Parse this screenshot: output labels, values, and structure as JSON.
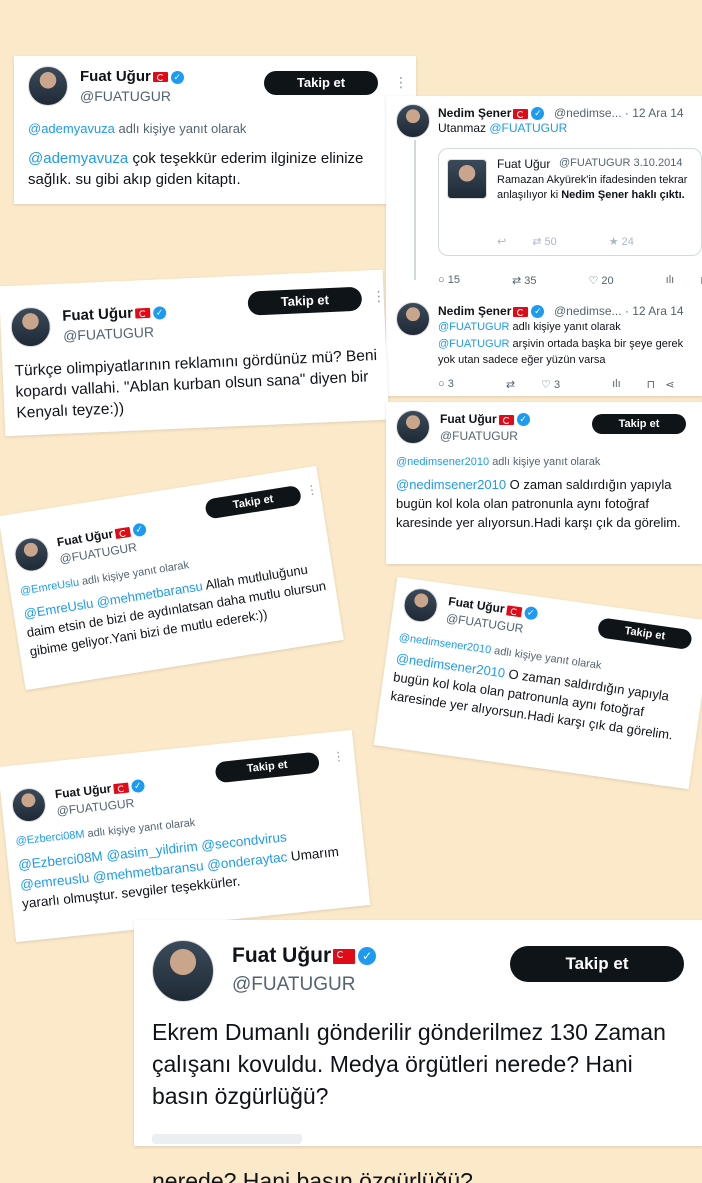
{
  "common": {
    "name": "Fuat Uğur",
    "handle": "@FUATUGUR",
    "follow": "Takip et",
    "reply_suffix": "adlı kişiye yanıt olarak",
    "more": "⋮"
  },
  "tweet1": {
    "reply_to": "@ademyavuza",
    "mention": "@ademyavuza",
    "text": " çok teşekkür ederim ilginize elinize sağlık. su gibi akıp giden kitaptı."
  },
  "nedim_thread": {
    "name": "Nedim Şener",
    "handle_time": "@nedimse... · 12 Ara 14",
    "text_prefix": "Utanmaz ",
    "text_mention": "@FUATUGUR",
    "quote": {
      "name": "Fuat Uğur",
      "handle_date": "@FUATUGUR 3.10.2014",
      "text": "Ramazan Akyürek'in ifadesinden tekrar anlaşılıyor ki ",
      "bold": "Nedim Şener haklı çıktı.",
      "retweets": "50",
      "likes": "24"
    },
    "actions": {
      "replies": "15",
      "retweets": "35",
      "likes": "20"
    },
    "reply2_handle_time": "@nedimse... · 12 Ara 14",
    "reply2_to": "@FUATUGUR",
    "reply2_text": " arşivin ortada başka bir şeye gerek yok utan sadece eğer yüzün varsa",
    "actions2": {
      "replies": "3",
      "likes": "3"
    }
  },
  "tweet2": {
    "text": "Türkçe olimpiyatlarının reklamını gördünüz mü? Beni kopardı vallahi. \"Ablan kurban olsun sana\" diyen bir Kenyalı teyze:))"
  },
  "tweet3": {
    "reply_to": "@nedimsener2010",
    "mention": "@nedimsener2010",
    "text": " O zaman saldırdığın yapıyla bugün kol kola olan patronunla aynı fotoğraf karesinde yer alıyorsun.Hadi karşı çık da görelim."
  },
  "tweet4": {
    "reply_to": "@EmreUslu",
    "mentions": "@EmreUslu @mehmetbaransu",
    "text": " Allah mutluluğunu daim etsin de bizi de aydınlatsan daha mutlu olursun gibime geliyor.Yani bizi de mutlu ederek:))"
  },
  "tweet5": {
    "reply_to": "@nedimsener2010",
    "mention": "@nedimsener2010",
    "text": " O zaman saldırdığın yapıyla bugün kol kola olan patronunla aynı fotoğraf karesinde yer alıyorsun.Hadi karşı çık da görelim."
  },
  "tweet6": {
    "reply_to": "@Ezberci08M",
    "mentions": "@Ezberci08M @asim_yildirim @secondvirus @emreuslu @mehmetbaransu @onderaytac",
    "text": " Umarım yararlı olmuştur. sevgiler teşekkürler."
  },
  "tweet7": {
    "text": "Ekrem Dumanlı gönderilir gönderilmez 130 Zaman çalışanı kovuldu. Medya örgütleri nerede? Hani basın özgürlüğü?",
    "cut_text": "nerede? Hani basın özgürlüğü?"
  }
}
